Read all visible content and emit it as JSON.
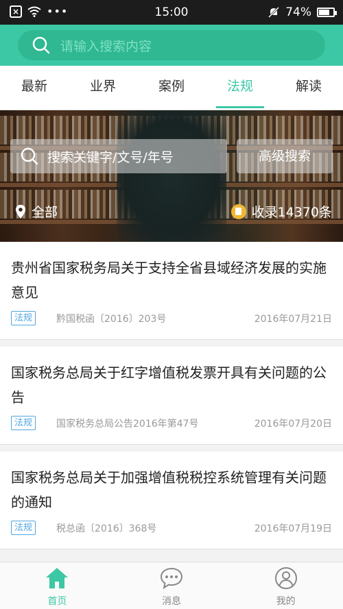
{
  "status_bar": {
    "time": "15:00",
    "battery": "74%",
    "dots": "•••"
  },
  "header": {
    "search_placeholder": "请输入搜索内容"
  },
  "tabs": [
    {
      "label": "最新",
      "active": false
    },
    {
      "label": "业界",
      "active": false
    },
    {
      "label": "案例",
      "active": false
    },
    {
      "label": "法规",
      "active": true
    },
    {
      "label": "解读",
      "active": false
    }
  ],
  "banner": {
    "search_placeholder": "搜索关键字/文号/年号",
    "advanced_search_label": "高级搜索",
    "location_label": "全部",
    "count_label": "收录14370条"
  },
  "articles": [
    {
      "title": "贵州省国家税务局关于支持全省县域经济发展的实施意见",
      "tag": "法规",
      "doc_no": "黔国税函〔2016〕203号",
      "date": "2016年07月21日"
    },
    {
      "title": "国家税务总局关于红字增值税发票开具有关问题的公告",
      "tag": "法规",
      "doc_no": "国家税务总局公告2016年第47号",
      "date": "2016年07月20日"
    },
    {
      "title": "国家税务总局关于加强增值税税控系统管理有关问题的通知",
      "tag": "法规",
      "doc_no": "税总函〔2016〕368号",
      "date": "2016年07月19日"
    }
  ],
  "bottom_nav": [
    {
      "label": "首页",
      "icon": "home-icon",
      "active": true
    },
    {
      "label": "消息",
      "icon": "chat-icon",
      "active": false
    },
    {
      "label": "我的",
      "icon": "user-icon",
      "active": false
    }
  ],
  "colors": {
    "accent": "#3dc8a5",
    "tag": "#4fa6e0"
  }
}
